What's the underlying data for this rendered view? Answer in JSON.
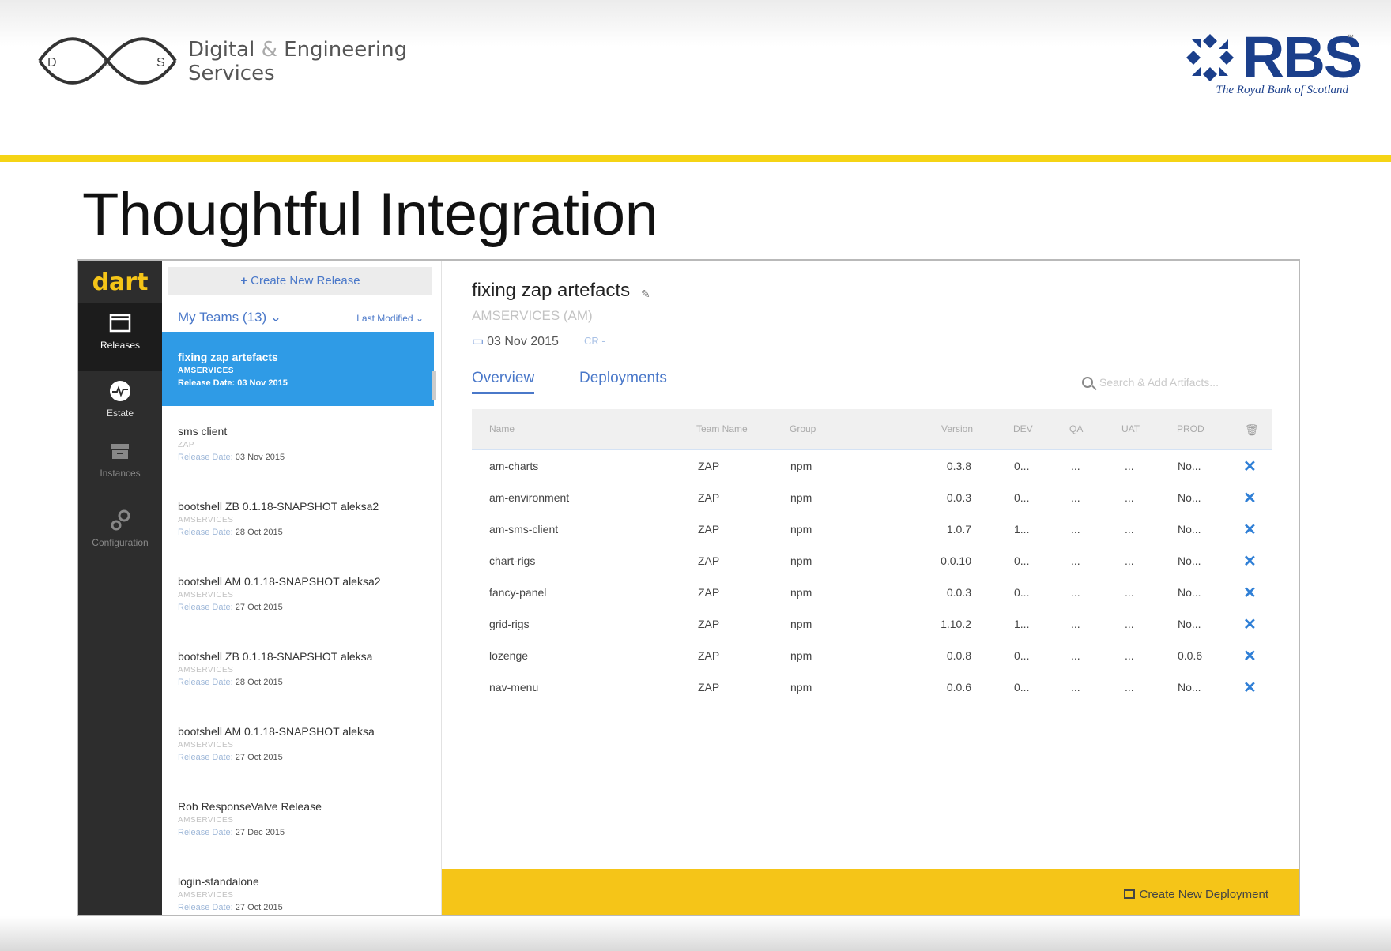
{
  "slide": {
    "des_letters": [
      "D",
      "E",
      "S"
    ],
    "des_line1_a": "Digital",
    "des_amp": "&",
    "des_line1_b": "Engineering",
    "des_line2": "Services",
    "rbs_word": "RBS",
    "rbs_tagline": "The Royal Bank of Scotland",
    "rbs_tm": "™",
    "title": "Thoughtful Integration",
    "colors": {
      "accent_yellow": "#f5d415",
      "rbs_blue": "#1b3f8b"
    }
  },
  "app": {
    "brand": "dart",
    "nav": [
      {
        "label": "Releases",
        "icon": "window-icon"
      },
      {
        "label": "Estate",
        "icon": "pulse-icon"
      },
      {
        "label": "Instances",
        "icon": "archive-icon"
      },
      {
        "label": "Configuration",
        "icon": "gears-icon"
      }
    ],
    "create_release": "Create New Release",
    "teams_filter": "My Teams (13)",
    "sort": "Last Modified",
    "release_date_label": "Release Date:",
    "releases": [
      {
        "name": "fixing zap artefacts",
        "team": "AMSERVICES",
        "date": "03 Nov 2015"
      },
      {
        "name": "sms client",
        "team": "ZAP",
        "date": "03 Nov 2015"
      },
      {
        "name": "bootshell ZB 0.1.18-SNAPSHOT aleksa2",
        "team": "AMSERVICES",
        "date": "28 Oct 2015"
      },
      {
        "name": "bootshell AM 0.1.18-SNAPSHOT aleksa2",
        "team": "AMSERVICES",
        "date": "27 Oct 2015"
      },
      {
        "name": "bootshell ZB 0.1.18-SNAPSHOT aleksa",
        "team": "AMSERVICES",
        "date": "28 Oct 2015"
      },
      {
        "name": "bootshell AM 0.1.18-SNAPSHOT aleksa",
        "team": "AMSERVICES",
        "date": "27 Oct 2015"
      },
      {
        "name": "Rob ResponseValve Release",
        "team": "AMSERVICES",
        "date": "27 Dec 2015"
      },
      {
        "name": "login-standalone",
        "team": "AMSERVICES",
        "date": "27 Oct 2015"
      }
    ],
    "detail": {
      "title": "fixing zap artefacts",
      "subtitle": "AMSERVICES (AM)",
      "date": "03 Nov 2015",
      "cr": "CR -",
      "tabs": [
        "Overview",
        "Deployments"
      ],
      "search_placeholder": "Search & Add Artifacts...",
      "columns": [
        "Name",
        "Team Name",
        "Group",
        "Version",
        "DEV",
        "QA",
        "UAT",
        "PROD"
      ],
      "rows": [
        {
          "name": "am-charts",
          "team": "ZAP",
          "group": "npm",
          "version": "0.3.8",
          "dev": "0...",
          "qa": "...",
          "uat": "...",
          "prod": "No..."
        },
        {
          "name": "am-environment",
          "team": "ZAP",
          "group": "npm",
          "version": "0.0.3",
          "dev": "0...",
          "qa": "...",
          "uat": "...",
          "prod": "No..."
        },
        {
          "name": "am-sms-client",
          "team": "ZAP",
          "group": "npm",
          "version": "1.0.7",
          "dev": "1...",
          "qa": "...",
          "uat": "...",
          "prod": "No..."
        },
        {
          "name": "chart-rigs",
          "team": "ZAP",
          "group": "npm",
          "version": "0.0.10",
          "dev": "0...",
          "qa": "...",
          "uat": "...",
          "prod": "No..."
        },
        {
          "name": "fancy-panel",
          "team": "ZAP",
          "group": "npm",
          "version": "0.0.3",
          "dev": "0...",
          "qa": "...",
          "uat": "...",
          "prod": "No..."
        },
        {
          "name": "grid-rigs",
          "team": "ZAP",
          "group": "npm",
          "version": "1.10.2",
          "dev": "1...",
          "qa": "...",
          "uat": "...",
          "prod": "No..."
        },
        {
          "name": "lozenge",
          "team": "ZAP",
          "group": "npm",
          "version": "0.0.8",
          "dev": "0...",
          "qa": "...",
          "uat": "...",
          "prod": "0.0.6"
        },
        {
          "name": "nav-menu",
          "team": "ZAP",
          "group": "npm",
          "version": "0.0.6",
          "dev": "0...",
          "qa": "...",
          "uat": "...",
          "prod": "No..."
        }
      ],
      "delete_glyph": "✕",
      "create_deployment": "Create New Deployment"
    }
  }
}
